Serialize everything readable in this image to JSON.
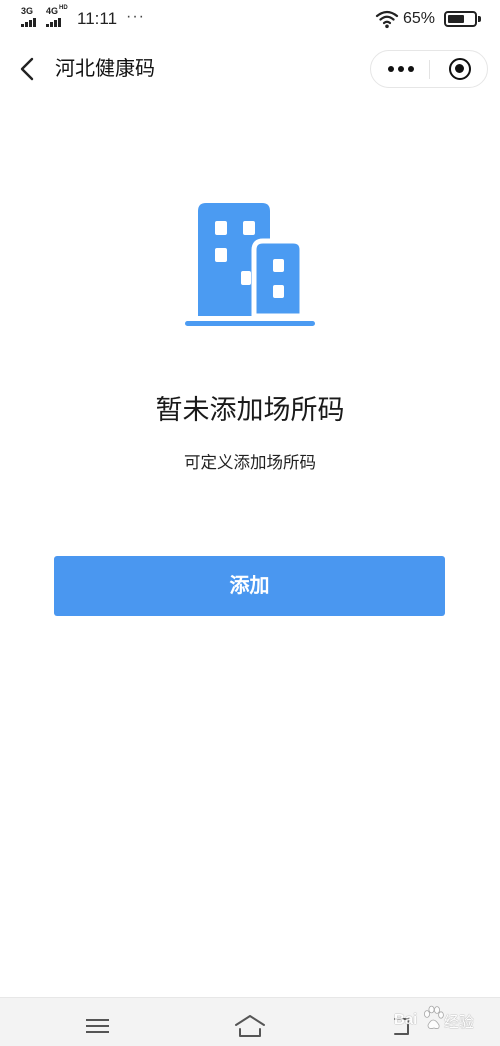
{
  "status_bar": {
    "network_1": "3G",
    "network_2": "4G",
    "network_2_badge": "HD",
    "time": "11:11",
    "more": "···",
    "battery_percent": "65%",
    "battery_level": 0.65,
    "icons": [
      "signal-icon",
      "wifi-icon",
      "battery-icon"
    ]
  },
  "nav": {
    "title": "河北健康码",
    "back_icon": "chevron-left-icon",
    "menu_icon": "more-dots-icon",
    "target_icon": "target-icon"
  },
  "empty_state": {
    "illustration_icon": "buildings-icon",
    "title": "暂未添加场所码",
    "subtitle": "可定义添加场所码"
  },
  "actions": {
    "add_label": "添加"
  },
  "system_nav": {
    "menu_icon": "menu-icon",
    "home_icon": "home-icon",
    "back_icon": "back-icon"
  },
  "watermark": {
    "brand": "Bai",
    "label": "经验"
  },
  "colors": {
    "accent": "#4A97F0",
    "illustration": "#4B9BF2",
    "text": "#1A1A1A",
    "background": "#FFFFFF",
    "system_bar": "#F3F3F3"
  }
}
